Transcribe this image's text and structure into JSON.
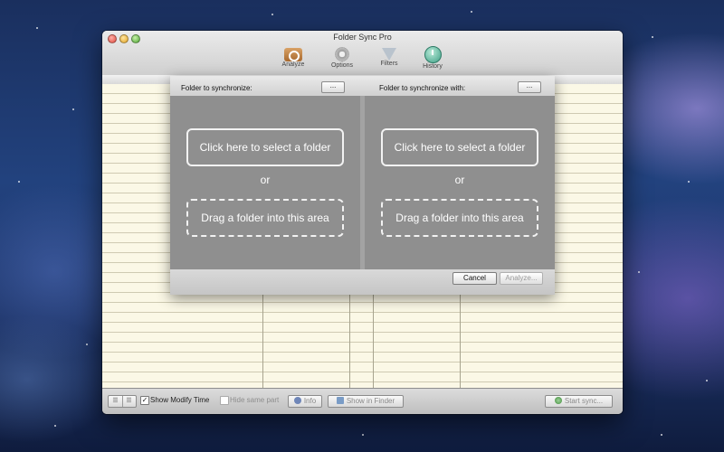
{
  "window": {
    "title": "Folder Sync Pro"
  },
  "toolbar": {
    "analyze_label": "Analyze",
    "options_label": "Options",
    "filters_label": "Filters",
    "history_label": "History"
  },
  "sheet": {
    "source_label": "Folder to synchronize:",
    "target_label": "Folder to synchronize with:",
    "browse_label": "...",
    "select_folder_label": "Click here to select a folder",
    "or_label": "or",
    "drag_label": "Drag a folder into this area",
    "cancel_label": "Cancel",
    "analyze_label": "Analyze..."
  },
  "bottombar": {
    "view_seg_left": "☰",
    "view_seg_right": "☰",
    "show_modify_time_label": "Show Modify Time",
    "show_modify_time_checked": "✓",
    "hide_same_part_label": "Hide same part",
    "info_label": "Info",
    "show_in_finder_label": "Show in Finder",
    "start_sync_label": "Start sync..."
  }
}
